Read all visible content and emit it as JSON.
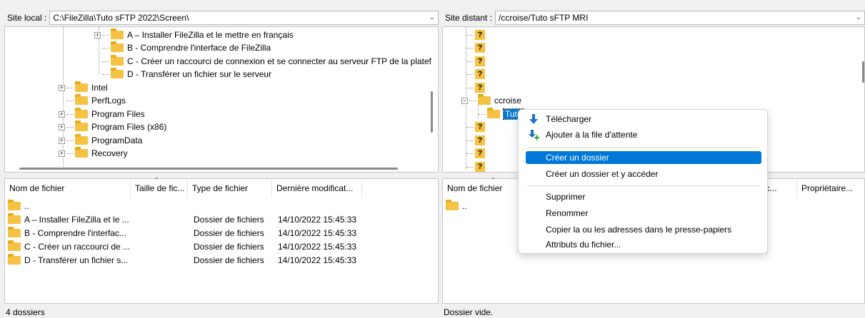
{
  "local": {
    "label": "Site local :",
    "path": "C:\\FileZilla\\Tuto sFTP 2022\\Screen\\",
    "tree": [
      {
        "name": "A – Installer FileZilla et le mettre en français"
      },
      {
        "name": "B - Comprendre l'interface de FileZilla"
      },
      {
        "name": "C - Créer un raccourci de connexion et se connecter au serveur FTP de la platef"
      },
      {
        "name": "D - Transférer un fichier sur le serveur"
      },
      {
        "name": "Intel"
      },
      {
        "name": "PerfLogs"
      },
      {
        "name": "Program Files"
      },
      {
        "name": "Program Files (x86)"
      },
      {
        "name": "ProgramData"
      },
      {
        "name": "Recovery"
      }
    ],
    "columns": [
      "Nom de fichier",
      "Taille de fic...",
      "Type de fichier",
      "Dernière modificat..."
    ],
    "files": [
      {
        "name": "..",
        "type": "",
        "date": ""
      },
      {
        "name": "A – Installer FileZilla et le ...",
        "type": "Dossier de fichiers",
        "date": "14/10/2022 15:45:33"
      },
      {
        "name": "B - Comprendre l'interfac...",
        "type": "Dossier de fichiers",
        "date": "14/10/2022 15:45:33"
      },
      {
        "name": "C - Créer un raccourci de ...",
        "type": "Dossier de fichiers",
        "date": "14/10/2022 15:45:33"
      },
      {
        "name": "D - Transférer un fichier s...",
        "type": "Dossier de fichiers",
        "date": "14/10/2022 15:45:33"
      }
    ],
    "status": "4 dossiers"
  },
  "remote": {
    "label": "Site distant :",
    "path": "/ccroise/Tuto sFTP MRI",
    "tree_unknown": "?",
    "tree_folder": "ccroise",
    "tree_selected": "Tuto",
    "columns": [
      "Nom de fichier",
      "d'ac...",
      "Propriétaire..."
    ],
    "files": [
      {
        "name": ".."
      }
    ],
    "status": "Dossier vide."
  },
  "context_menu": {
    "items": [
      {
        "label": "Télécharger",
        "icon": "download-icon"
      },
      {
        "label": "Ajouter à la file d'attente",
        "icon": "add-queue-icon"
      },
      {
        "label": "Créer un dossier",
        "selected": true
      },
      {
        "label": "Créer un dossier et y accéder"
      },
      {
        "label": "Supprimer"
      },
      {
        "label": "Renommer"
      },
      {
        "label": "Copier la ou les adresses dans le presse-papiers"
      },
      {
        "label": "Attributs du fichier..."
      }
    ]
  },
  "colors": {
    "selection": "#0078d7",
    "folder": "#f6c243"
  }
}
